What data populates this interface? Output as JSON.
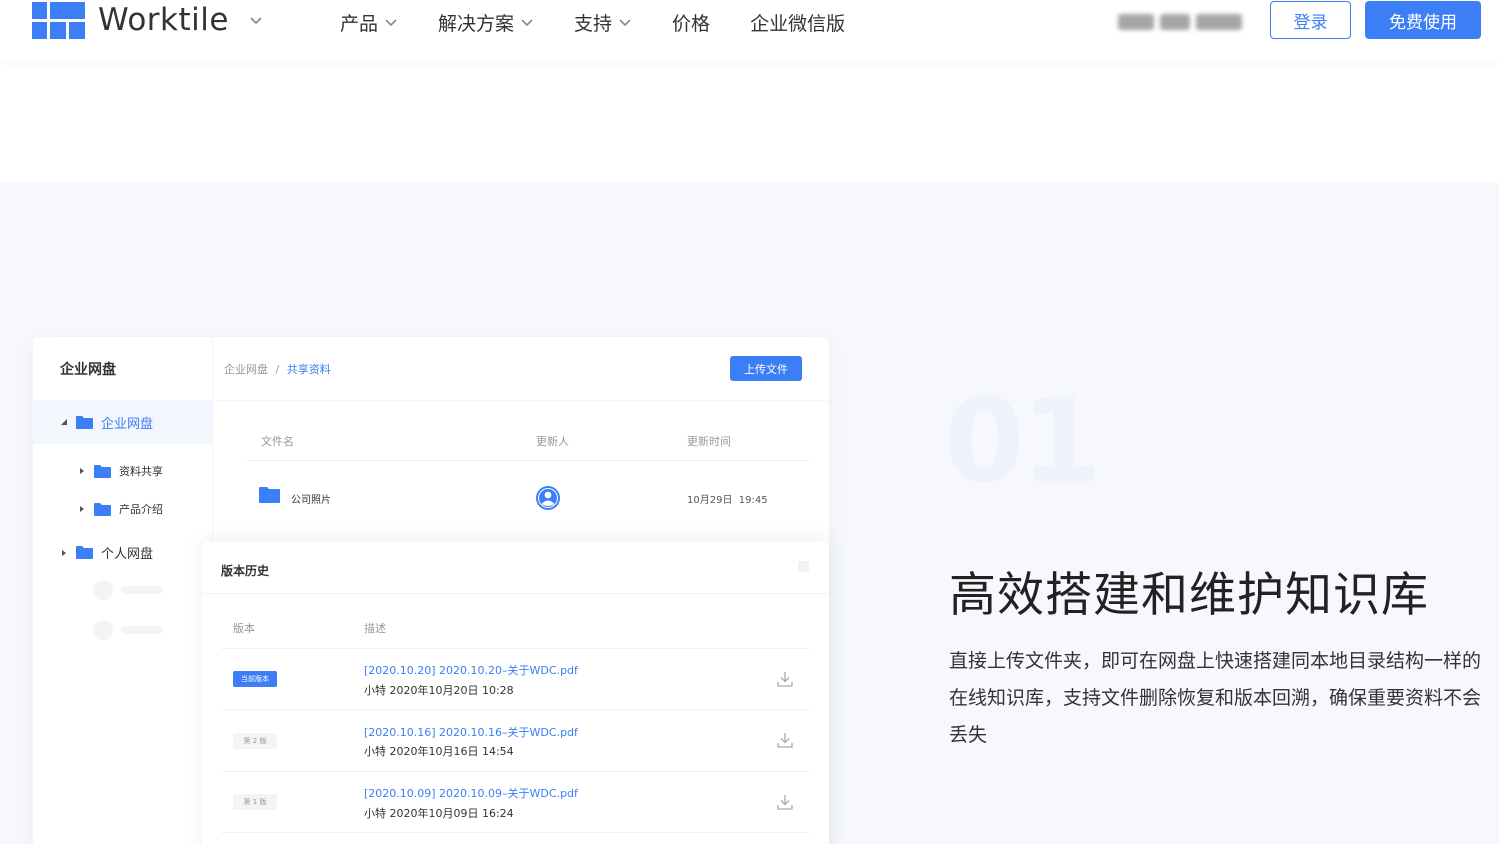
{
  "header": {
    "logo_text": "Worktile",
    "nav": [
      {
        "label": "产品",
        "has_dropdown": true
      },
      {
        "label": "解决方案",
        "has_dropdown": true
      },
      {
        "label": "支持",
        "has_dropdown": true
      },
      {
        "label": "价格",
        "has_dropdown": false
      },
      {
        "label": "企业微信版",
        "has_dropdown": false
      }
    ],
    "login_label": "登录",
    "free_label": "免费使用"
  },
  "colors": {
    "brand": "#3b7ef5",
    "text": "#333333",
    "muted": "#999999",
    "bg": "#f6f8fd"
  },
  "drive": {
    "sidebar_title": "企业网盘",
    "tree": [
      {
        "label": "企业网盘",
        "level": 1,
        "expanded": true,
        "active": true
      },
      {
        "label": "资料共享",
        "level": 2
      },
      {
        "label": "产品介绍",
        "level": 2
      },
      {
        "label": "个人网盘",
        "level": 1
      }
    ],
    "breadcrumb": {
      "root": "企业网盘",
      "sep": "/",
      "current": "共享资料"
    },
    "upload_label": "上传文件",
    "columns": [
      "文件名",
      "更新人",
      "更新时间"
    ],
    "files": [
      {
        "name": "公司照片",
        "updated": "10月29日  19:45",
        "icon": "folder-icon",
        "avatar": "user-avatar-icon"
      }
    ]
  },
  "version_history": {
    "title": "版本历史",
    "columns": [
      "版本",
      "描述"
    ],
    "rows": [
      {
        "badge": "当前版本",
        "current": true,
        "file": "[2020.10.20] 2020.10.20–关于WDC.pdf",
        "meta": "小特 2020年10月20日 10:28"
      },
      {
        "badge": "第 2 版",
        "current": false,
        "file": "[2020.10.16] 2020.10.16–关于WDC.pdf",
        "meta": "小特 2020年10月16日 14:54"
      },
      {
        "badge": "第 1 版",
        "current": false,
        "file": "[2020.10.09] 2020.10.09–关于WDC.pdf",
        "meta": "小特 2020年10月09日 16:24"
      }
    ]
  },
  "feature": {
    "number": "01",
    "headline": "高效搭建和维护知识库",
    "description": "直接上传文件夹，即可在网盘上快速搭建同本地目录结构一样的在线知识库，支持文件删除恢复和版本回溯，确保重要资料不会丢失"
  }
}
